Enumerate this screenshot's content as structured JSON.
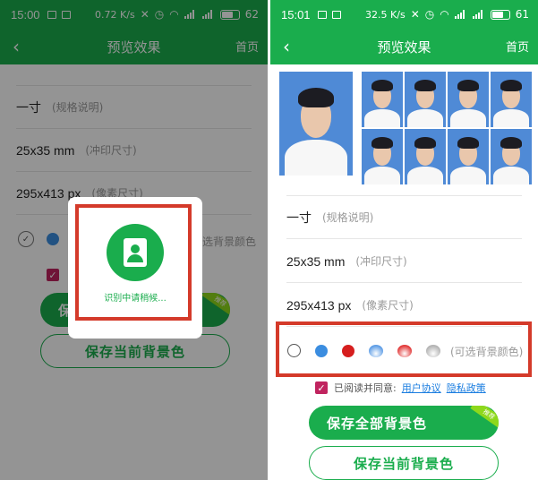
{
  "left": {
    "status": {
      "time": "15:00",
      "speed": "0.72 K/s",
      "battery": "62"
    },
    "nav": {
      "back": "‹",
      "title": "预览效果",
      "home": "首页"
    },
    "specs": [
      {
        "main": "一寸",
        "sub": "(规格说明)"
      },
      {
        "main": "25x35 mm",
        "sub": "(冲印尺寸)"
      },
      {
        "main": "295x413 px",
        "sub": "(像素尺寸)"
      }
    ],
    "colors_hint": "选背景颜色",
    "save_all": "保存全部背景色",
    "save_all_visible": "保",
    "save_all_ribbon": "推荐",
    "save_current": "保存当前背景色",
    "dialog": {
      "loading": "识别中请稍候..."
    }
  },
  "right": {
    "status": {
      "time": "15:01",
      "speed": "32.5 K/s",
      "battery": "61"
    },
    "nav": {
      "back": "‹",
      "title": "预览效果",
      "home": "首页"
    },
    "specs": [
      {
        "main": "一寸",
        "sub": "(规格说明)"
      },
      {
        "main": "25x35 mm",
        "sub": "(冲印尺寸)"
      },
      {
        "main": "295x413 px",
        "sub": "(像素尺寸)"
      }
    ],
    "colors_hint": "(可选背景颜色)",
    "agree": {
      "prefix": "已阅读并同意:",
      "user_agreement": "用户协议",
      "privacy": "隐私政策"
    },
    "save_all": "保存全部背景色",
    "save_all_ribbon": "推荐",
    "save_current": "保存当前背景色"
  },
  "theme": {
    "primary": "#1aad4d",
    "highlight": "#d43a2a",
    "checkbox": "#c0245f",
    "link": "#1a7de0"
  },
  "background_colors": [
    {
      "name": "white",
      "color": "#ffffff"
    },
    {
      "name": "blue",
      "color": "#3b8de0"
    },
    {
      "name": "red",
      "color": "#d61e1e"
    },
    {
      "name": "blue-gradient",
      "color": "#5f9ee6"
    },
    {
      "name": "red-gradient",
      "color": "#e23a3a"
    },
    {
      "name": "gray-gradient",
      "color": "#b3b3b3"
    }
  ]
}
